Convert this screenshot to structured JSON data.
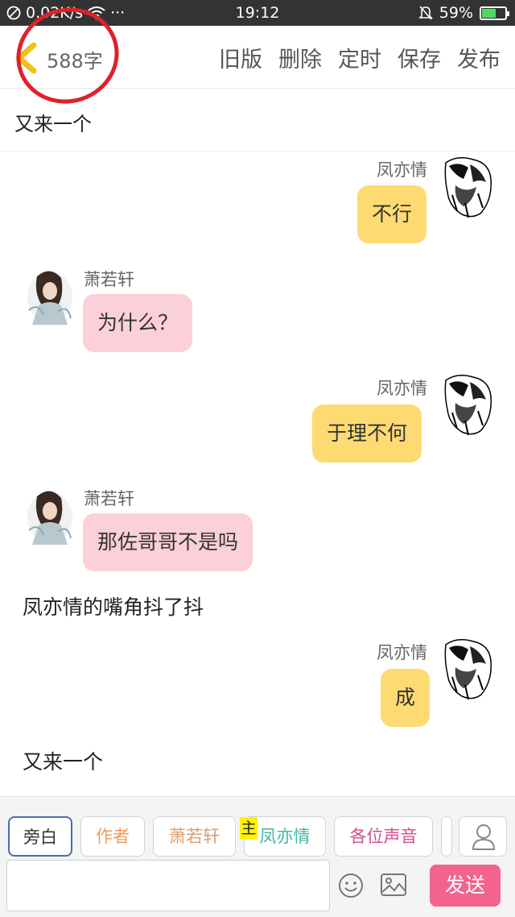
{
  "status_bar": {
    "speed": "0.02K/s",
    "more": "···",
    "time": "19:12",
    "battery_percent": "59%",
    "battery_level": 0.59
  },
  "toolbar": {
    "word_count": "588字",
    "actions": [
      "旧版",
      "删除",
      "定时",
      "保存",
      "发布"
    ]
  },
  "title": "又来一个",
  "messages": [
    {
      "speaker": "凤亦情",
      "text": "不行"
    },
    {
      "speaker": "萧若轩",
      "text": "为什么？"
    },
    {
      "speaker": "凤亦情",
      "text": "于理不何"
    },
    {
      "speaker": "萧若轩",
      "text": "那佐哥哥不是吗"
    },
    {
      "narration": "凤亦情的嘴角抖了抖"
    },
    {
      "speaker": "凤亦情",
      "text": "成"
    },
    {
      "narration": "又来一个"
    }
  ],
  "roles": [
    "旁白",
    "作者",
    "萧若轩",
    "凤亦情",
    "各位声音"
  ],
  "role_badge": "主",
  "input": {
    "value": ""
  },
  "send_label": "发送",
  "colors": {
    "yellow_bubble": "#fddb72",
    "pink_bubble": "#fcd0d8",
    "send_button": "#f2638f",
    "author_chip": "#f09a5a",
    "xiao_chip": "#d9a070",
    "feng_chip": "#3db8a6",
    "voices_chip": "#d64b8f"
  }
}
